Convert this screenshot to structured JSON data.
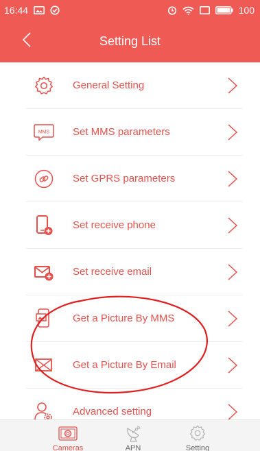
{
  "status_bar": {
    "time": "16:44",
    "battery": "100",
    "icons": [
      "image-icon",
      "check-circle-icon",
      "alarm-icon",
      "wifi-icon",
      "screen-icon",
      "battery-icon"
    ]
  },
  "header": {
    "title": "Setting List",
    "back_icon": "chevron-left-icon"
  },
  "settings": [
    {
      "label": "General Setting",
      "icon": "gear-icon"
    },
    {
      "label": "Set MMS parameters",
      "icon": "mms-icon"
    },
    {
      "label": "Set GPRS parameters",
      "icon": "link-icon"
    },
    {
      "label": "Set receive phone",
      "icon": "phone-add-icon"
    },
    {
      "label": "Set receive email",
      "icon": "mail-add-icon"
    },
    {
      "label": "Get a Picture By MMS",
      "icon": "phone-picture-icon"
    },
    {
      "label": "Get a Picture By Email",
      "icon": "envelope-icon"
    },
    {
      "label": "Advanced setting",
      "icon": "user-gear-icon"
    }
  ],
  "tabs": [
    {
      "label": "Cameras",
      "icon": "camera-icon",
      "active": true
    },
    {
      "label": "APN",
      "icon": "satellite-icon",
      "active": false
    },
    {
      "label": "Setting",
      "icon": "gear-icon",
      "active": false
    }
  ],
  "colors": {
    "accent": "#ef5a55",
    "text_accent": "#e4514d",
    "annotation": "#e02020",
    "tab_inactive": "#b0b0b0"
  }
}
